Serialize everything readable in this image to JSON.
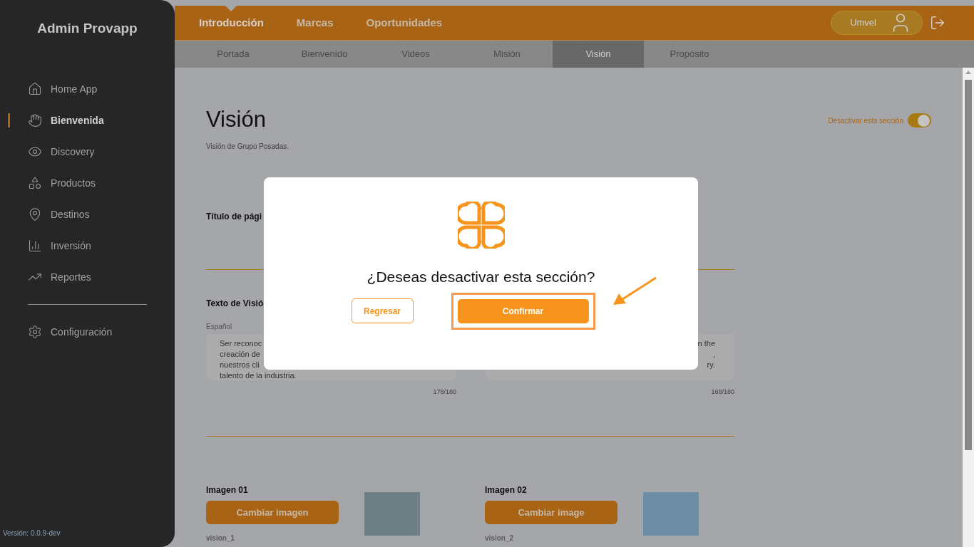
{
  "sidebar": {
    "title": "Admin Provapp",
    "items": [
      {
        "label": "Home App",
        "selected": false
      },
      {
        "label": "Bienvenida",
        "selected": true
      },
      {
        "label": "Discovery",
        "selected": false
      },
      {
        "label": "Productos",
        "selected": false
      },
      {
        "label": "Destinos",
        "selected": false
      },
      {
        "label": "Inversión",
        "selected": false
      },
      {
        "label": "Reportes",
        "selected": false
      }
    ],
    "bottom_items": [
      {
        "label": "Configuración",
        "selected": false
      }
    ],
    "version": "Versión: 0.0.9-dev"
  },
  "top_tabs": [
    {
      "label": "Introducción",
      "selected": true
    },
    {
      "label": "Marcas",
      "selected": false
    },
    {
      "label": "Oportunidades",
      "selected": false
    }
  ],
  "user": {
    "name": "Umvel"
  },
  "sub_tabs": [
    {
      "label": "Portada",
      "selected": false
    },
    {
      "label": "Bienvenido",
      "selected": false
    },
    {
      "label": "Videos",
      "selected": false
    },
    {
      "label": "Misión",
      "selected": false
    },
    {
      "label": "Visión",
      "selected": true
    },
    {
      "label": "Propósito",
      "selected": false
    }
  ],
  "page": {
    "title": "Visión",
    "subtitle": "Visión de Grupo Posadas.",
    "toggle": {
      "label": "Desactivar esta sección",
      "on": true
    },
    "title_section": {
      "label": "Título de pági"
    },
    "text_section": {
      "label": "Texto de Visió",
      "field_label": "Español",
      "left_lines": [
        "Ser reconoc",
        "creación de",
        "nuestros cli",
        "talento de la industria."
      ],
      "right_lines": [
        "n the",
        ",",
        "ry."
      ],
      "left_count": "178/180",
      "right_count": "168/180"
    },
    "images": [
      {
        "label": "Imagen 01",
        "button": "Cambiar imagen",
        "file": "vision_1"
      },
      {
        "label": "Imagen 02",
        "button": "Cambiar image",
        "file": "vision_2"
      }
    ]
  },
  "dialog": {
    "question": "¿Deseas desactivar esta sección?",
    "back_button": "Regresar",
    "confirm_button": "Confirmar"
  }
}
